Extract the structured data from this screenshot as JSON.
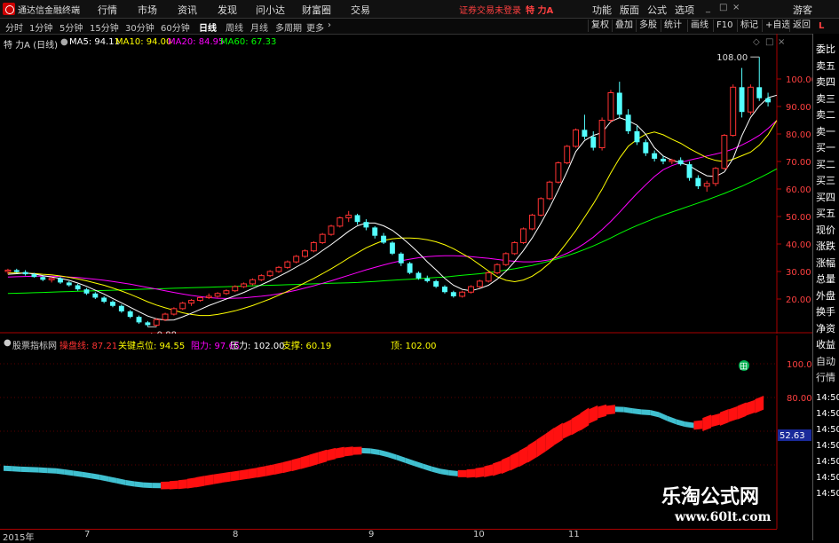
{
  "menubar": {
    "app_name": "通达信金融终端",
    "menus": [
      "行情",
      "市场",
      "资讯",
      "发现",
      "问小达",
      "财富圈",
      "交易"
    ],
    "login_notice": "证券交易未登录",
    "stock_name": "特 力A",
    "right_menus": [
      "功能",
      "版面",
      "公式",
      "选项"
    ],
    "guest": "游客"
  },
  "period_tabs": [
    "分时",
    "1分钟",
    "5分钟",
    "15分钟",
    "30分钟",
    "60分钟",
    "日线",
    "周线",
    "月线",
    "多周期",
    "更多"
  ],
  "active_period": "日线",
  "right_tabs": [
    "复权",
    "叠加",
    "多股",
    "统计",
    "画线",
    "F10",
    "标记",
    "+自选",
    "返回"
  ],
  "main_legend": {
    "title": "特 力A (日线)",
    "ma5": "MA5: 94.11",
    "ma10": "MA10: 94.00",
    "ma20": "MA20: 84.95",
    "ma60": "MA60: 67.33"
  },
  "price_axis": [
    "100.00",
    "90.00",
    "80.00",
    "70.00",
    "60.00",
    "50.00",
    "40.00",
    "30.00",
    "20.00"
  ],
  "annotations": {
    "high": "108.00",
    "low": "9.88"
  },
  "indicator_legend": {
    "name": "股票指标网",
    "cpx": "操盘线: 87.21",
    "key": "关键点位: 94.55",
    "resist": "阻力: 97.65",
    "pressure": "压力: 102.00",
    "support": "支撑: 60.19",
    "top": "顶: 102.00"
  },
  "indicator_axis": [
    "100.0",
    "80.00"
  ],
  "indicator_current": "52.63",
  "indicator_badge": "田",
  "dates": [
    "2015年",
    "7",
    "8",
    "9",
    "10",
    "11"
  ],
  "right_panel": [
    "委比",
    "卖五",
    "卖四",
    "卖三",
    "卖二",
    "卖一",
    "买一",
    "买二",
    "买三",
    "买四",
    "买五",
    "现价",
    "涨跌",
    "涨幅",
    "总量",
    "外盘",
    "换手",
    "净资",
    "收益",
    "自动",
    "行情"
  ],
  "right_panel_times": [
    "14:50",
    "14:50",
    "14:50",
    "14:50",
    "14:50",
    "14:50",
    "14:50"
  ],
  "watermark": {
    "line1": "乐淘公式网",
    "line2": "www.60lt.com"
  },
  "colors": {
    "up": "#ff3232",
    "down": "#54ffff",
    "ma5": "#ffffff",
    "ma10": "#ffff00",
    "ma20": "#ff00ff",
    "ma60": "#00ff00",
    "ind_up": "#ff1010",
    "ind_down": "#40c0d0"
  },
  "chart_data": {
    "type": "candlestick",
    "price_range": [
      10,
      110
    ],
    "candles": [
      [
        30,
        31,
        29,
        30.5
      ],
      [
        30.5,
        31,
        29.5,
        29.8
      ],
      [
        29.8,
        30.5,
        28.5,
        29
      ],
      [
        29,
        29.5,
        27.8,
        28
      ],
      [
        28,
        28.5,
        26.5,
        27
      ],
      [
        27,
        28,
        26,
        27.5
      ],
      [
        27.5,
        28,
        25.5,
        26
      ],
      [
        26,
        26.5,
        24.5,
        25
      ],
      [
        25,
        25.5,
        23,
        23.5
      ],
      [
        23.5,
        24,
        21.5,
        22
      ],
      [
        22,
        22.5,
        20,
        20.5
      ],
      [
        20.5,
        21,
        18.5,
        19
      ],
      [
        19,
        19.5,
        17,
        17.5
      ],
      [
        17.5,
        18,
        15,
        15.5
      ],
      [
        15.5,
        16,
        13,
        13.5
      ],
      [
        13.5,
        14,
        11,
        11.5
      ],
      [
        11.5,
        12,
        9.88,
        10.5
      ],
      [
        10.5,
        13,
        10,
        12.5
      ],
      [
        12.5,
        15,
        12,
        14.5
      ],
      [
        14.5,
        17,
        14,
        16.5
      ],
      [
        16.5,
        19,
        16,
        18.5
      ],
      [
        18.5,
        20,
        17.5,
        19.5
      ],
      [
        19.5,
        21,
        19,
        20.5
      ],
      [
        20.5,
        22,
        20,
        21
      ],
      [
        21,
        22.5,
        20.5,
        22
      ],
      [
        22,
        23.5,
        21.5,
        23
      ],
      [
        23,
        25,
        22.5,
        24.5
      ],
      [
        24.5,
        26,
        24,
        25.5
      ],
      [
        25.5,
        27.5,
        25,
        27
      ],
      [
        27,
        29,
        26.5,
        28.5
      ],
      [
        28.5,
        30.5,
        28,
        30
      ],
      [
        30,
        32,
        29.5,
        31.5
      ],
      [
        31.5,
        34,
        31,
        33.5
      ],
      [
        33.5,
        36,
        33,
        35.5
      ],
      [
        35.5,
        38,
        35,
        37.5
      ],
      [
        37.5,
        41,
        37,
        40.5
      ],
      [
        40.5,
        44,
        40,
        43.5
      ],
      [
        43.5,
        47,
        43,
        46.5
      ],
      [
        46.5,
        50,
        46,
        49.5
      ],
      [
        49.5,
        52,
        48,
        50.5
      ],
      [
        50.5,
        51,
        47,
        48
      ],
      [
        48,
        49,
        45,
        46
      ],
      [
        46,
        46.5,
        42,
        43
      ],
      [
        43,
        44,
        40,
        40.5
      ],
      [
        40.5,
        41,
        36,
        36.5
      ],
      [
        36.5,
        37,
        32,
        33
      ],
      [
        33,
        33.5,
        29,
        29.5
      ],
      [
        29.5,
        30,
        27,
        27.5
      ],
      [
        27.5,
        28.5,
        26,
        26.5
      ],
      [
        26.5,
        27,
        24,
        24.5
      ],
      [
        24.5,
        25,
        22,
        22.5
      ],
      [
        22.5,
        23,
        20.5,
        21
      ],
      [
        21,
        23,
        20.5,
        22.5
      ],
      [
        22.5,
        25,
        22,
        24.5
      ],
      [
        24.5,
        27,
        24,
        26.5
      ],
      [
        26.5,
        30,
        26,
        29.5
      ],
      [
        29.5,
        33,
        29,
        32.5
      ],
      [
        32.5,
        37,
        32,
        36.5
      ],
      [
        36.5,
        41,
        36,
        40.5
      ],
      [
        40.5,
        46,
        40,
        45.5
      ],
      [
        45.5,
        51,
        45,
        50.5
      ],
      [
        50.5,
        57,
        50,
        56.5
      ],
      [
        56.5,
        63,
        56,
        62.5
      ],
      [
        62.5,
        70,
        62,
        69.5
      ],
      [
        69.5,
        76,
        69,
        75.5
      ],
      [
        75.5,
        82,
        75,
        81.5
      ],
      [
        81.5,
        87,
        78,
        79
      ],
      [
        79,
        81,
        74,
        75
      ],
      [
        75,
        86,
        74,
        85
      ],
      [
        85,
        96,
        84,
        95
      ],
      [
        95,
        99,
        86,
        87
      ],
      [
        87,
        89,
        80,
        81
      ],
      [
        81,
        83,
        76,
        77
      ],
      [
        77,
        78,
        72,
        73
      ],
      [
        73,
        74,
        70,
        71
      ],
      [
        71,
        72,
        69,
        70
      ],
      [
        70,
        71,
        69,
        70.5
      ],
      [
        70.5,
        71.5,
        68.5,
        69
      ],
      [
        69,
        70,
        63,
        64
      ],
      [
        64,
        65,
        60,
        61
      ],
      [
        61,
        63,
        59,
        62
      ],
      [
        62,
        68,
        61,
        67.5
      ],
      [
        67.5,
        80,
        67,
        79.5
      ],
      [
        79.5,
        98,
        79,
        97
      ],
      [
        97,
        104,
        86,
        88
      ],
      [
        88,
        98,
        87,
        97
      ],
      [
        97,
        108,
        92,
        93
      ],
      [
        93,
        95,
        90,
        91.5
      ]
    ],
    "ma5": [
      29,
      29.2,
      29.5,
      29.1,
      28.5,
      28,
      27.5,
      26.8,
      25.8,
      24.6,
      23.2,
      21.8,
      20.2,
      18.6,
      17,
      15.4,
      13.8,
      12.8,
      12.3,
      12.4,
      13.5,
      14.8,
      16.2,
      17.6,
      18.8,
      20,
      21.2,
      22.4,
      23.8,
      25.2,
      26.6,
      28.2,
      29.8,
      31.6,
      33.4,
      35.4,
      37.6,
      39.8,
      42.2,
      44.6,
      46.6,
      47.6,
      47.6,
      46.6,
      45,
      42.5,
      39.8,
      36.8,
      33.5,
      30.6,
      27.5,
      25,
      23.5,
      23,
      23.8,
      25,
      27.2,
      30.1,
      33.6,
      37.6,
      42.2,
      47.5,
      53.3,
      59.6,
      66.3,
      73.6,
      77.6,
      79.5,
      80.5,
      84.5,
      85.9,
      84.8,
      83.2,
      79.9,
      75,
      72,
      70.5,
      69.5,
      68.5,
      66.5,
      64.8,
      64.5,
      66.2,
      71.1,
      79.4,
      86,
      90.2,
      93.2,
      94.1
    ],
    "ma10": [
      29.5,
      29.5,
      29.4,
      29.3,
      29,
      28.8,
      28.4,
      27.9,
      27.3,
      26.6,
      25.8,
      25,
      24,
      22.9,
      21.7,
      20.4,
      19,
      17.8,
      16.8,
      15.9,
      15,
      14.4,
      14,
      14,
      14.4,
      15,
      15.7,
      16.6,
      17.6,
      18.8,
      20,
      21.4,
      22.8,
      24.3,
      25.9,
      27.5,
      29.2,
      31,
      32.9,
      34.9,
      36.8,
      38.6,
      40,
      41.3,
      41.9,
      42.2,
      42.2,
      42,
      41.5,
      40.8,
      39.7,
      38.3,
      36.5,
      34.7,
      32.5,
      30.2,
      28.1,
      26.8,
      26.3,
      26.9,
      28.3,
      30.4,
      33.1,
      36.6,
      40.6,
      44.9,
      49.7,
      54.6,
      59.9,
      65.8,
      71.2,
      75.5,
      78,
      79.9,
      80.7,
      79.7,
      78.1,
      76.6,
      74.7,
      73,
      71.4,
      70.4,
      69.9,
      70.8,
      72.1,
      73.4,
      75.9,
      79.7,
      84.9
    ],
    "ma20": [
      28,
      28.1,
      28.2,
      28.3,
      28.3,
      28.3,
      28.2,
      28,
      27.8,
      27.5,
      27.2,
      26.8,
      26.4,
      25.9,
      25.4,
      24.8,
      24.2,
      23.6,
      23,
      22.4,
      21.8,
      21.3,
      20.9,
      20.5,
      20.3,
      20.2,
      20.3,
      20.4,
      20.7,
      21,
      21.4,
      21.9,
      22.5,
      23.2,
      24,
      24.8,
      25.7,
      26.6,
      27.6,
      28.6,
      29.6,
      30.6,
      31.5,
      32.4,
      33.2,
      33.9,
      34.5,
      35,
      35.4,
      35.6,
      35.7,
      35.7,
      35.6,
      35.4,
      35.1,
      34.8,
      34.4,
      34,
      33.7,
      33.5,
      33.5,
      33.8,
      34.3,
      35.3,
      36.6,
      38.2,
      40.2,
      42.5,
      45.2,
      48.2,
      51.5,
      55,
      58.4,
      61.5,
      64.5,
      67,
      68.5,
      69.6,
      70.5,
      71.2,
      72,
      72.7,
      73.5,
      74.5,
      76,
      77.6,
      79.5,
      82,
      84.95
    ],
    "ma60": [
      22,
      22.1,
      22.2,
      22.3,
      22.4,
      22.5,
      22.6,
      22.7,
      22.8,
      22.9,
      23,
      23.1,
      23.2,
      23.3,
      23.4,
      23.5,
      23.6,
      23.7,
      23.8,
      23.9,
      24,
      24.1,
      24.2,
      24.3,
      24.4,
      24.5,
      24.6,
      24.7,
      24.8,
      24.9,
      25,
      25.1,
      25.2,
      25.3,
      25.4,
      25.5,
      25.6,
      25.7,
      25.8,
      25.9,
      26,
      26.2,
      26.4,
      26.6,
      26.8,
      27,
      27.2,
      27.4,
      27.6,
      27.8,
      28,
      28.3,
      28.6,
      28.9,
      29.2,
      29.6,
      30,
      30.5,
      31,
      31.6,
      32.2,
      33,
      33.8,
      34.7,
      35.7,
      36.8,
      38,
      39.3,
      40.7,
      42.2,
      43.8,
      45.3,
      46.7,
      48,
      49.3,
      50.5,
      51.6,
      52.7,
      53.8,
      54.9,
      56,
      57.2,
      58.4,
      59.7,
      61,
      62.5,
      64,
      65.6,
      67.33
    ]
  }
}
